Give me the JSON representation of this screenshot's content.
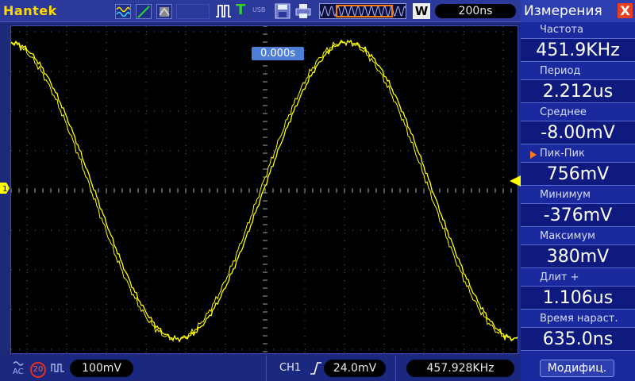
{
  "topbar": {
    "brand": "Hantek",
    "trigger_mode_label": "T",
    "usb_label": "USB",
    "wave_zoom_label": "W",
    "timebase": "200ns",
    "trigger_position": "0.000s",
    "icons": [
      "waveform-icon",
      "ramp-icon",
      "persistence-icon",
      "pulse-icon",
      "save-icon",
      "print-icon"
    ]
  },
  "colors": {
    "trace": "#ffff00",
    "accent": "#ff7a1a",
    "panel": "#1a2a9e",
    "value_box": "#0f1a7e",
    "trig_pos": "#4d7ed8"
  },
  "measurements": {
    "title": "Измерения",
    "close_label": "X",
    "items": [
      {
        "label": "Частота",
        "value": "451.9KHz",
        "selected": false
      },
      {
        "label": "Период",
        "value": "2.212us",
        "selected": false
      },
      {
        "label": "Среднее",
        "value": "-8.00mV",
        "selected": false
      },
      {
        "label": "Пик-Пик",
        "value": "756mV",
        "selected": true
      },
      {
        "label": "Минимум",
        "value": "-376mV",
        "selected": false
      },
      {
        "label": "Максимум",
        "value": "380mV",
        "selected": false
      },
      {
        "label": "Длит +",
        "value": "1.106us",
        "selected": false
      },
      {
        "label": "Время нараст.",
        "value": "635.0ns",
        "selected": false
      }
    ],
    "modify_label": "Модифиц."
  },
  "bottombar": {
    "coupling": "AC",
    "bw_limit": "20",
    "ch1_scale": "100mV",
    "trigger_source": "CH1",
    "trigger_level": "24.0mV",
    "frequency": "457.928KHz"
  },
  "ch1_marker": "1"
}
